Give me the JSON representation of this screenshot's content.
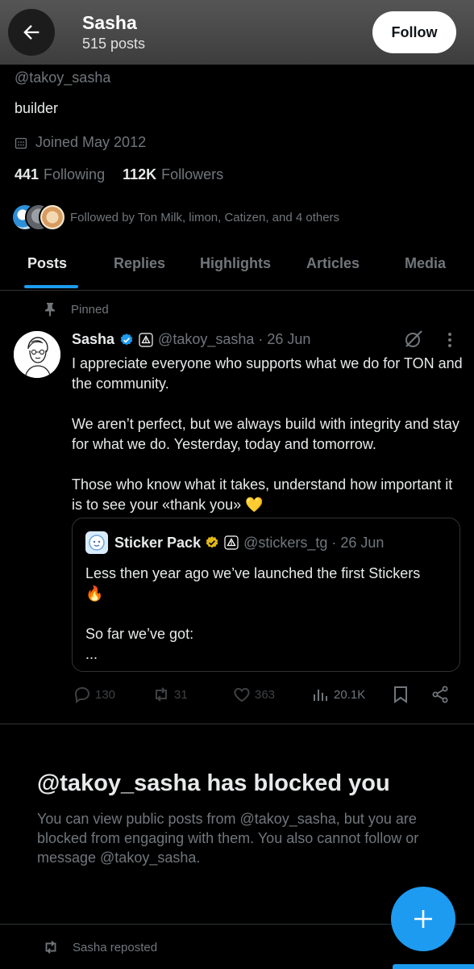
{
  "header": {
    "name": "Sasha",
    "posts_count": "515 posts",
    "follow_label": "Follow"
  },
  "profile": {
    "handle": "@takoy_sasha",
    "bio": "builder",
    "joined": "Joined May 2012",
    "following_count": "441",
    "following_label": "Following",
    "followers_count": "112K",
    "followers_label": "Followers",
    "followed_by": "Followed by Ton Milk, limon, Catizen, and 4 others"
  },
  "tabs": [
    {
      "label": "Posts",
      "active": true
    },
    {
      "label": "Replies",
      "active": false
    },
    {
      "label": "Highlights",
      "active": false
    },
    {
      "label": "Articles",
      "active": false
    },
    {
      "label": "Media",
      "active": false
    }
  ],
  "pinned_post": {
    "pinned_label": "Pinned",
    "author_name": "Sasha",
    "meta": "@takoy_sasha · 26 Jun",
    "paragraphs": [
      "I appreciate everyone who supports what we do for TON and the community.",
      "We aren’t perfect, but we always build with integrity and stay for what we do. Yesterday, today and tomorrow.",
      "Those who know what it takes, understand how important it is to see your «thank you» 💛"
    ],
    "quote": {
      "author_name": "Sticker Pack",
      "meta": "@stickers_tg · 26 Jun",
      "lines": [
        "Less then year ago we’ve launched the first Stickers",
        "🔥",
        "",
        "So far we’ve got:",
        "..."
      ]
    },
    "actions": {
      "replies": "130",
      "reposts": "31",
      "likes": "363",
      "views": "20.1K"
    }
  },
  "blocked": {
    "title": "@takoy_sasha has blocked you",
    "message": "You can view public posts from @takoy_sasha, but you are blocked from engaging with them. You also cannot follow or message @takoy_sasha."
  },
  "reposted_label": "Sasha reposted",
  "colors": {
    "accent": "#1d9bf0",
    "background": "#000000",
    "muted_text": "#71767b",
    "verified_gold": "#e2b719",
    "heart_yellow": "#ffd43b"
  }
}
